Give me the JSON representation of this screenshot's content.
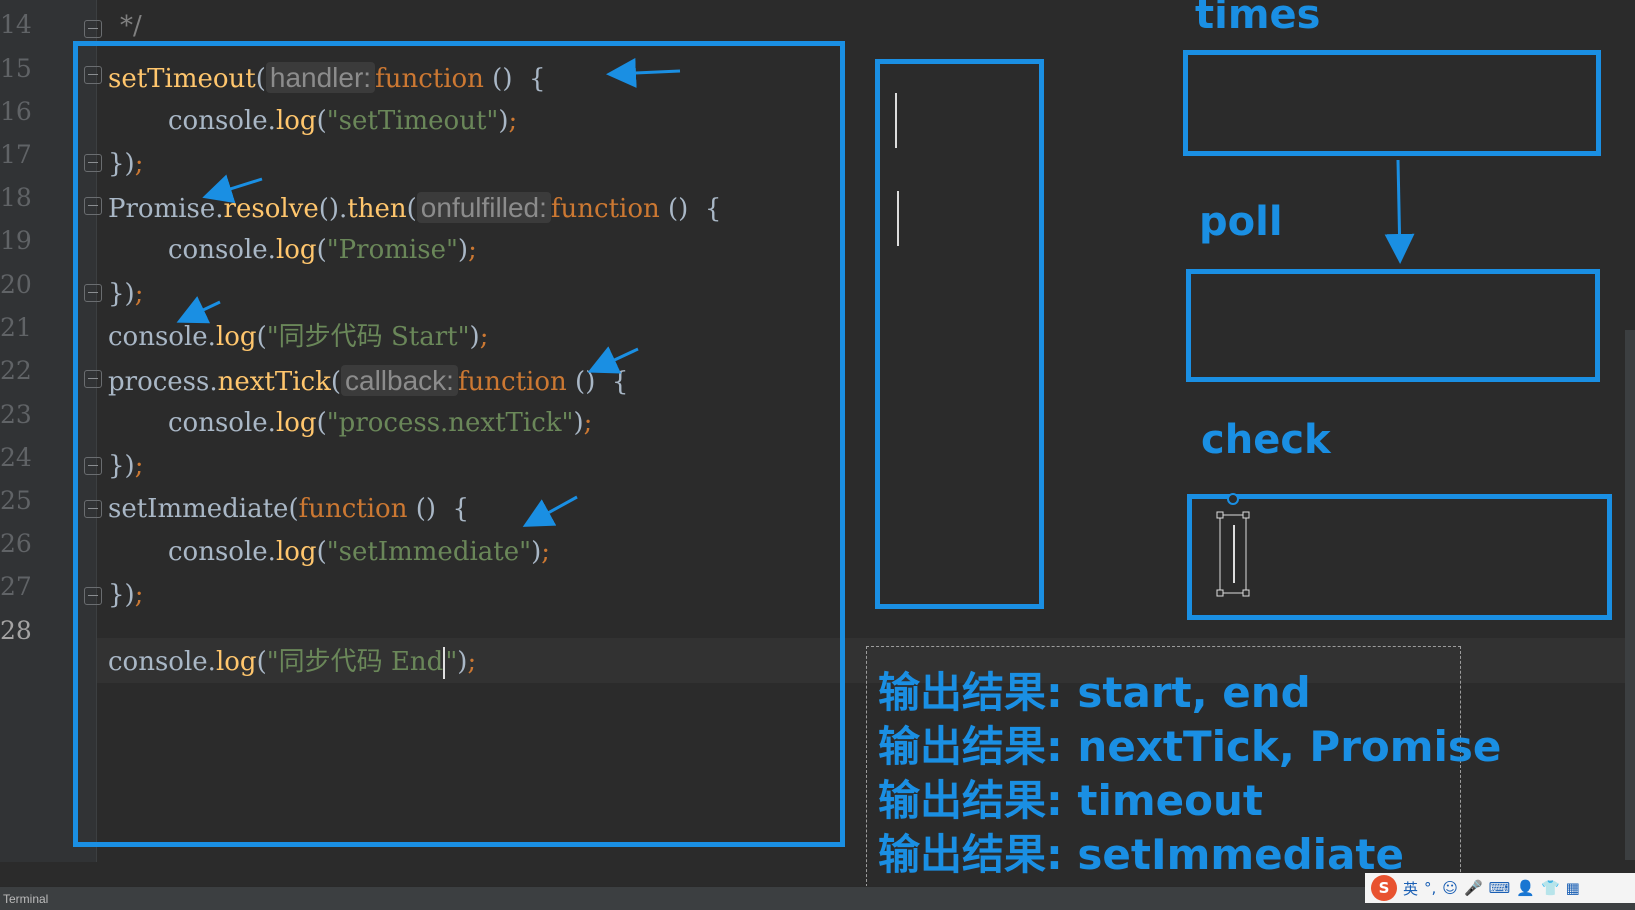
{
  "editor": {
    "line_numbers": [
      "14",
      "15",
      "16",
      "17",
      "18",
      "19",
      "20",
      "21",
      "22",
      "23",
      "24",
      "25",
      "26",
      "27",
      "28"
    ],
    "comment_close": "*/",
    "lines": {
      "l15": {
        "fn": "setTimeout",
        "p1": "(",
        "hint": "handler:",
        "kw": "function",
        "p2": " ()  {"
      },
      "l16": {
        "p1": "console.",
        "fn": "log",
        "p2": "(",
        "str": "\"setTimeout\"",
        "p3": ")",
        "semi": ";"
      },
      "l17": {
        "p1": "})",
        "semi": ";"
      },
      "l18": {
        "p1": "Promise.",
        "fn1": "resolve",
        "p2": "().",
        "fn2": "then",
        "p3": "(",
        "hint": "onfulfilled:",
        "kw": "function",
        "p4": " ()  {"
      },
      "l19": {
        "p1": "console.",
        "fn": "log",
        "p2": "(",
        "str": "\"Promise\"",
        "p3": ")",
        "semi": ";"
      },
      "l20": {
        "p1": "})",
        "semi": ";"
      },
      "l21": {
        "p1": "console.",
        "fn": "log",
        "p2": "(",
        "str": "\"同步代码 Start\"",
        "p3": ")",
        "semi": ";"
      },
      "l22": {
        "p1": "process.",
        "fn": "nextTick",
        "p2": "(",
        "hint": "callback:",
        "kw": "function",
        "p3": " ()  {"
      },
      "l23": {
        "p1": "console.",
        "fn": "log",
        "p2": "(",
        "str": "\"process.nextTick\"",
        "p3": ")",
        "semi": ";"
      },
      "l24": {
        "p1": "})",
        "semi": ";"
      },
      "l25": {
        "fn": "setImmediate",
        "p1": "(",
        "kw": "function",
        "p2": " ()  {"
      },
      "l26": {
        "p1": "console.",
        "fn": "log",
        "p2": "(",
        "str": "\"setImmediate\"",
        "p3": ")",
        "semi": ";"
      },
      "l27": {
        "p1": "})",
        "semi": ";"
      },
      "l28": {
        "p1": "console.",
        "fn": "log",
        "p2": "(",
        "str1": "\"同步代码 End",
        "str2": "\"",
        "p3": ")",
        "semi": ";"
      }
    }
  },
  "diagram": {
    "labels": {
      "times": "times",
      "poll": "poll",
      "check": "check"
    },
    "results": [
      "输出结果: start, end",
      "输出结果: nextTick, Promise",
      "输出结果: timeout",
      "输出结果: setImmediate"
    ],
    "accent_color": "#1a8fe3"
  },
  "statusbar": {
    "terminal_label": "Terminal",
    "ime_lang": "英"
  }
}
